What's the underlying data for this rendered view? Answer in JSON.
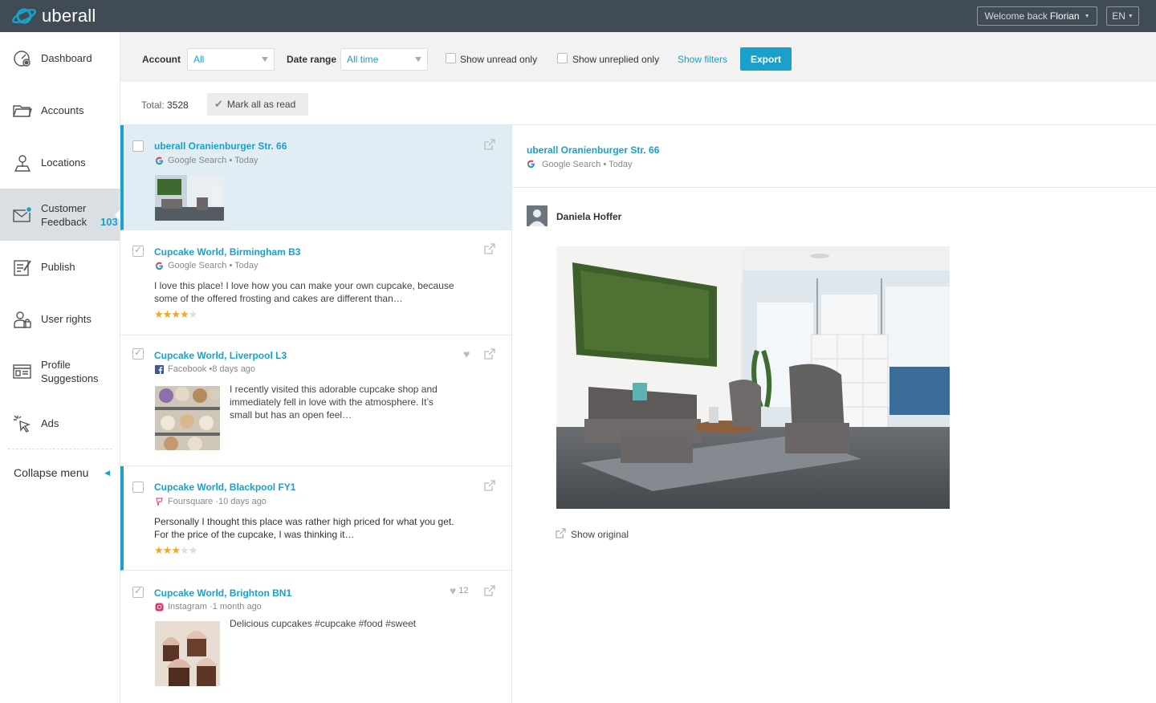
{
  "brand": {
    "name": "uberall",
    "accent": "#1aa0c9",
    "topbar": "#414b56"
  },
  "header": {
    "welcome": "Welcome back",
    "user": "Florian",
    "language": "EN"
  },
  "sidebar": {
    "items": [
      {
        "label": "Dashboard",
        "icon": "dashboard-icon"
      },
      {
        "label": "Accounts",
        "icon": "folder-icon"
      },
      {
        "label": "Locations",
        "icon": "location-pin-icon"
      },
      {
        "label": "Customer Feedback",
        "count": "103",
        "icon": "envelope-icon",
        "active": true
      },
      {
        "label": "Publish",
        "icon": "publish-icon"
      },
      {
        "label": "User rights",
        "icon": "users-icon"
      },
      {
        "label": "Profile Suggestions",
        "icon": "profile-card-icon"
      },
      {
        "label": "Ads",
        "icon": "cursor-click-icon"
      }
    ],
    "collapse": "Collapse menu"
  },
  "filters": {
    "account_label": "Account",
    "account_value": "All",
    "date_label": "Date range",
    "date_value": "All time",
    "unread_label": "Show unread only",
    "unreplied_label": "Show unreplied only",
    "show_filters": "Show filters",
    "export": "Export"
  },
  "summary": {
    "total_label": "Total:",
    "total_value": "3528",
    "mark_all": "Mark all as read"
  },
  "feed": [
    {
      "title": "uberall Oranienburger Str. 66",
      "source": "Google Search",
      "time": "• Today",
      "checked": false
    },
    {
      "title": "Cupcake World, Birmingham B3",
      "source": "Google Search",
      "time": "• Today",
      "text": "I love this place! I love how you can make your own cupcake, because some of the offered frosting and cakes are different than…",
      "rating": 4,
      "checked": true
    },
    {
      "title": "Cupcake World, Liverpool L3",
      "source": "Facebook",
      "time": "•8 days ago",
      "text": "I recently visited this adorable cupcake shop and immediately fell in love with the atmosphere. It’s small but has an open feel…",
      "checked": true
    },
    {
      "title": "Cupcake World, Blackpool FY1",
      "source": "Foursquare",
      "time": "·10 days ago",
      "text": "Personally I thought this place was rather high priced for what you get. For the price of the cupcake, I was thinking it…",
      "rating": 3,
      "checked": false
    },
    {
      "title": "Cupcake World, Brighton BN1",
      "source": "Instagram",
      "time": "·1 month ago",
      "text": "Delicious cupcakes #cupcake #food #sweet",
      "likes": "12",
      "checked": true
    }
  ],
  "detail": {
    "title": "uberall Oranienburger Str. 66",
    "source": "Google Search",
    "time": "• Today",
    "author": "Daniela Hoffer",
    "show_original": "Show original"
  }
}
